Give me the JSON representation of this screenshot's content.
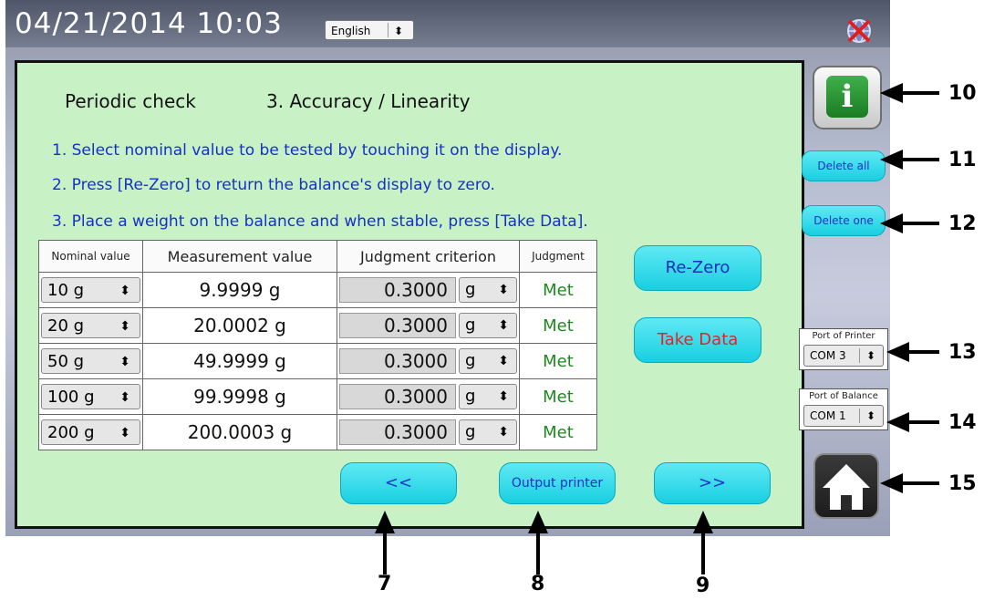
{
  "topbar": {
    "datetime": "04/21/2014  10:03",
    "language": "English"
  },
  "panel": {
    "title_left": "Periodic check",
    "title_right": "3. Accuracy / Linearity",
    "instructions": [
      "1. Select nominal value to be tested by touching it on the display.",
      "2. Press [Re-Zero] to return the balance's display to zero.",
      "3. Place a weight on the balance and when stable, press [Take Data]."
    ]
  },
  "table": {
    "headers": [
      "Nominal value",
      "Measurement value",
      "Judgment criterion",
      "Judgment"
    ],
    "rows": [
      {
        "nominal": "10 g",
        "measurement": "9.9999  g",
        "criterion": "0.3000",
        "unit": "g",
        "judgment": "Met"
      },
      {
        "nominal": "20 g",
        "measurement": "20.0002  g",
        "criterion": "0.3000",
        "unit": "g",
        "judgment": "Met"
      },
      {
        "nominal": "50 g",
        "measurement": "49.9999  g",
        "criterion": "0.3000",
        "unit": "g",
        "judgment": "Met"
      },
      {
        "nominal": "100 g",
        "measurement": "99.9998  g",
        "criterion": "0.3000",
        "unit": "g",
        "judgment": "Met"
      },
      {
        "nominal": "200 g",
        "measurement": "200.0003  g",
        "criterion": "0.3000",
        "unit": "g",
        "judgment": "Met"
      }
    ]
  },
  "buttons": {
    "rezero": "Re-Zero",
    "take_data": "Take Data",
    "prev": "<<",
    "output_printer": "Output printer",
    "next": ">>",
    "delete_all": "Delete all",
    "delete_one": "Delete one",
    "info": "i"
  },
  "ports": {
    "printer_label": "Port of Printer",
    "printer_value": "COM 3",
    "balance_label": "Port of Balance",
    "balance_value": "COM 1"
  },
  "callouts": [
    "7",
    "8",
    "9",
    "10",
    "11",
    "12",
    "13",
    "14",
    "15"
  ],
  "icons": {
    "select_arrows": "⬍",
    "network": "network-disconnected-icon",
    "home": "home-icon"
  },
  "colors": {
    "panel": "#c8f2c6",
    "button": "#19cfe1",
    "instruction_text": "#1730c8",
    "take_data_text": "#e0242a",
    "met_text": "#1e8a1e"
  }
}
